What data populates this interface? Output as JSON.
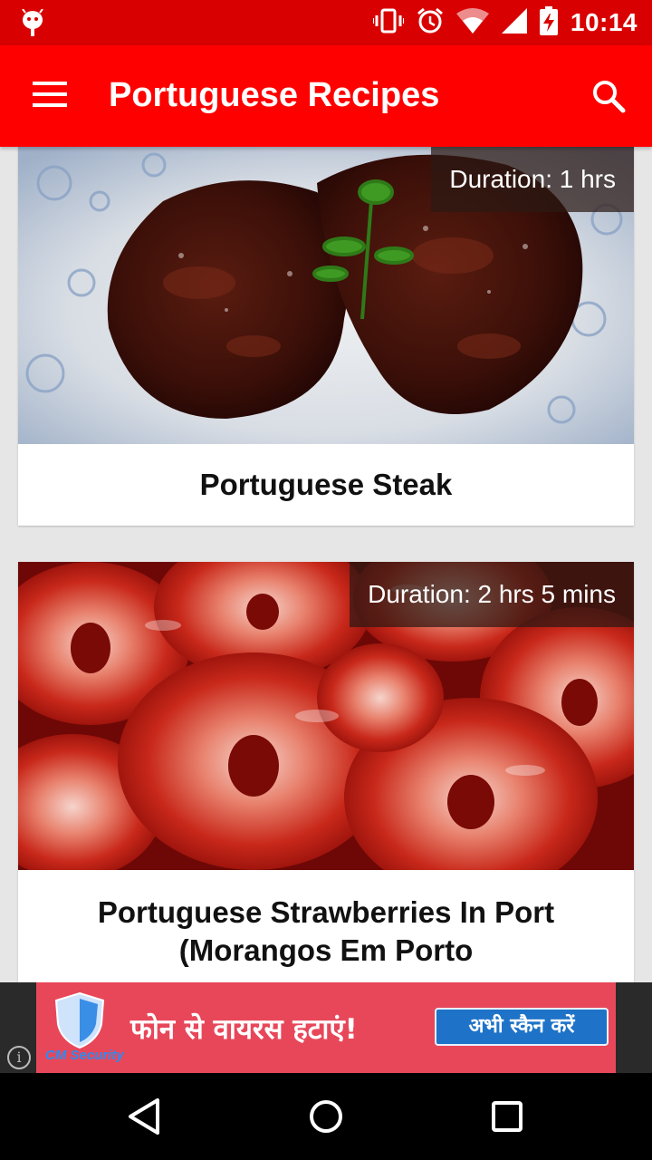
{
  "status_bar": {
    "time": "10:14",
    "icons": [
      "android-debug-icon",
      "vibrate-icon",
      "alarm-icon",
      "wifi-icon",
      "signal-icon",
      "battery-charging-icon"
    ]
  },
  "app_bar": {
    "title": "Portuguese Recipes",
    "menu_icon": "hamburger-menu-icon",
    "search_icon": "search-icon"
  },
  "recipes": [
    {
      "duration": "Duration: 1 hrs",
      "title": "Portuguese Steak"
    },
    {
      "duration": "Duration: 2 hrs 5 mins",
      "title": "Portuguese Strawberries In Port (Morangos Em Porto"
    }
  ],
  "ad": {
    "brand": "CM Security",
    "message": "फोन से वायरस हटाएं!",
    "button": "अभी स्कैन करें",
    "info_icon": "info-icon"
  },
  "nav_bar": {
    "icons": [
      "back-icon",
      "home-icon",
      "recents-icon"
    ]
  },
  "colors": {
    "status_bar": "#d80000",
    "app_bar": "#ff0000",
    "background": "#e6e6e6",
    "ad_background": "#e8475a",
    "ad_button": "#1e73c8"
  }
}
